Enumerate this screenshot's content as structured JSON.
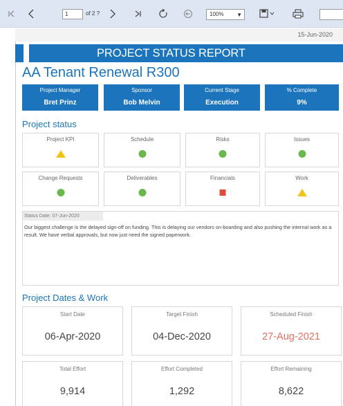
{
  "toolbar": {
    "icons": {
      "first": "first-page-icon",
      "prev": "previous-page-icon",
      "next": "next-page-icon",
      "last": "last-page-icon",
      "refresh": "refresh-icon",
      "back": "back-icon",
      "save": "save-icon",
      "print": "print-icon"
    },
    "page_value": "1",
    "page_of": "of 2 ?",
    "zoom": "100%"
  },
  "report": {
    "date": "15-Jun-2020",
    "title": "PROJECT STATUS REPORT",
    "project_name": "AA Tenant Renewal R300",
    "info": [
      {
        "label": "Project Manager",
        "value": "Bret Prinz"
      },
      {
        "label": "Sponsor",
        "value": "Bob Melvin"
      },
      {
        "label": "Current Stage",
        "value": "Execution"
      },
      {
        "label": "% Complete",
        "value": "9%"
      }
    ],
    "status_section_title": "Project status",
    "status_cards": [
      {
        "label": "Project KPI",
        "indicator": "yellow-triangle",
        "color": "#f0c419"
      },
      {
        "label": "Schedule",
        "indicator": "green-circle",
        "color": "#6ab84c"
      },
      {
        "label": "Risks",
        "indicator": "green-circle",
        "color": "#6ab84c"
      },
      {
        "label": "Issues",
        "indicator": "green-circle",
        "color": "#6ab84c"
      },
      {
        "label": "Change Requests",
        "indicator": "green-circle",
        "color": "#6ab84c"
      },
      {
        "label": "Deliverables",
        "indicator": "green-circle",
        "color": "#6ab84c"
      },
      {
        "label": "Financials",
        "indicator": "red-diamond",
        "color": "#e04b3c"
      },
      {
        "label": "Work",
        "indicator": "yellow-triangle",
        "color": "#f0c419"
      }
    ],
    "status_note": {
      "date": "Status Date: 07-Jun-2020",
      "text": "Our biggest challenge is the delayed sign-off on funding. This is delaying our vendors on-boarding and also pushing the internal work as a result. We have verbal approvals, but now just need the signed paperwork."
    },
    "dates_section_title": "Project Dates & Work",
    "dates": [
      {
        "label": "Start Date",
        "value": "06-Apr-2020"
      },
      {
        "label": "Target Finish",
        "value": "04-Dec-2020"
      },
      {
        "label": "Scheduled Finish",
        "value": "27-Aug-2021"
      }
    ],
    "work": [
      {
        "label": "Total Effort",
        "value": "9,914"
      },
      {
        "label": "Effort Completed",
        "value": "1,292"
      },
      {
        "label": "Effort Remaining",
        "value": "8,622"
      }
    ]
  },
  "colors": {
    "brand_blue": "#1c75bc",
    "green": "#6ab84c",
    "yellow": "#f0c419",
    "red": "#e04b3c",
    "late_date": "#e07060"
  }
}
